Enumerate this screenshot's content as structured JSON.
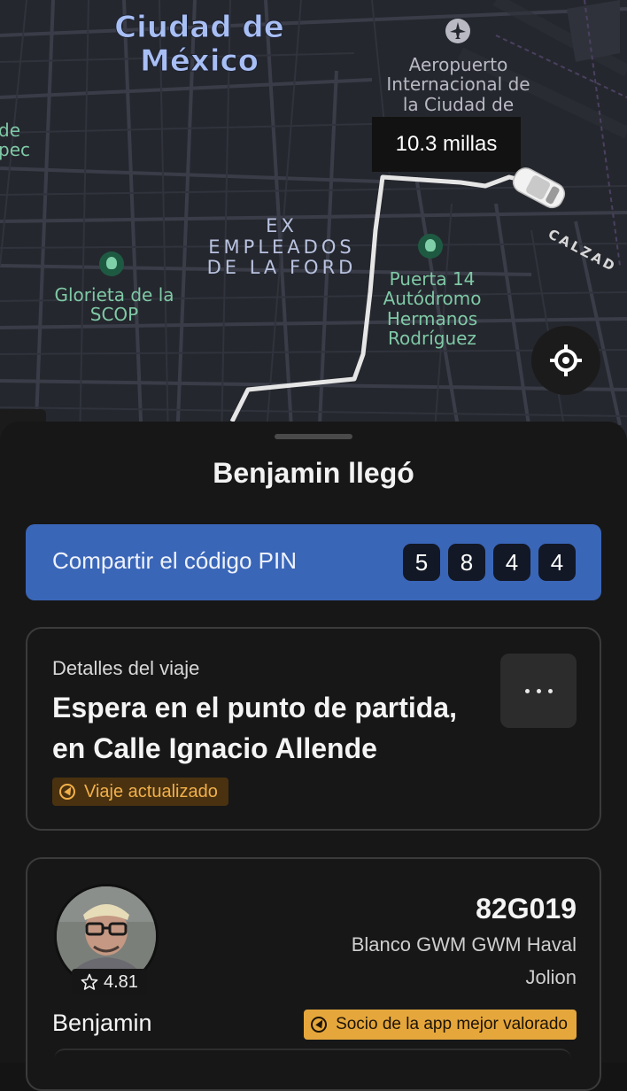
{
  "map": {
    "city_label": "Ciudad de México",
    "airport_label": "Aeropuerto Internacional de la Ciudad de",
    "neighborhood_label": "EX EMPLEADOS DE LA FORD",
    "park_left_label": "Glorieta de la SCOP",
    "park_right_label": "Puerta 14 Autódromo Hermanos Rodríguez",
    "street_label": "CALZAD",
    "edge_label_left": "de\npec",
    "distance": "10.3 millas",
    "route_color": "#e6e6e6",
    "icons": [
      "airport-icon",
      "park-icon",
      "car-icon",
      "locate-icon"
    ]
  },
  "sheet": {
    "title": "Benjamin llegó",
    "pin": {
      "label": "Compartir el código PIN",
      "digits": [
        "5",
        "8",
        "4",
        "4"
      ],
      "color": "#3a66b8"
    },
    "trip": {
      "section_label": "Detalles del viaje",
      "instruction": "Espera en el punto de partida, en Calle Ignacio Allende",
      "badge": "Viaje actualizado",
      "badge_color": "#f1b04a"
    },
    "driver": {
      "rating": "4.81",
      "plate": "82G019",
      "vehicle": "Blanco GWM GWM Haval Jolion",
      "name": "Benjamin",
      "badge": "Socio de la app mejor valorado",
      "badge_color": "#e5a63b"
    }
  }
}
